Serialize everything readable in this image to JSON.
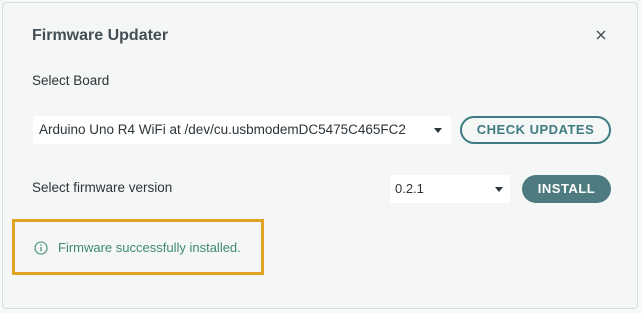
{
  "dialog": {
    "title": "Firmware Updater",
    "close_icon": "close-icon"
  },
  "board": {
    "label": "Select Board",
    "selected": "Arduino Uno R4 WiFi at /dev/cu.usbmodemDC5475C465FC2",
    "check_updates_label": "CHECK UPDATES"
  },
  "firmware": {
    "label": "Select firmware version",
    "selected_version": "0.2.1",
    "install_label": "INSTALL"
  },
  "status": {
    "icon": "info-icon",
    "message": "Firmware successfully installed."
  },
  "colors": {
    "accent": "#3f7c82",
    "install_button": "#4e7b80",
    "success_text": "#3f8a76",
    "highlight_border": "#e0a324"
  }
}
